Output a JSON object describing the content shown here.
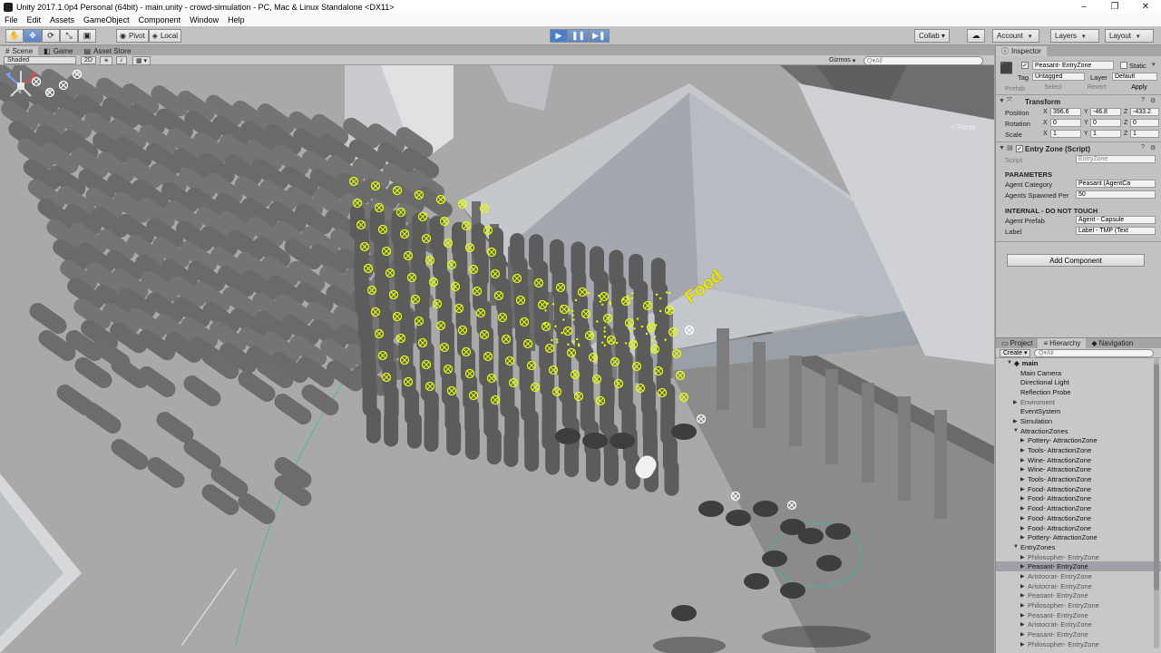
{
  "window": {
    "title": "Unity 2017.1.0p4 Personal (64bit) - main.unity - crowd-simulation - PC, Mac & Linux Standalone <DX11>",
    "controls": [
      "–",
      "❐",
      "✕"
    ]
  },
  "menu": [
    "File",
    "Edit",
    "Assets",
    "GameObject",
    "Component",
    "Window",
    "Help"
  ],
  "toolbar": {
    "pivot": "Pivot",
    "local": "Local",
    "collab": "Collab ▾",
    "account": "Account",
    "layers": "Layers",
    "layout": "Layout",
    "play_state": "playing"
  },
  "scene_tabs": [
    "Scene",
    "Game",
    "Asset Store"
  ],
  "scene_toolbar": {
    "shading": "Shaded",
    "mode_2d": "2D",
    "gizmos": "Gizmos",
    "search_placeholder": "Q▾All"
  },
  "viewport": {
    "projection": "< Persp",
    "world_label": "Food",
    "accent_color": "#e8ff00"
  },
  "inspector": {
    "tab": "Inspector",
    "object_name": "Peasant- EntryZone",
    "static_label": "Static",
    "tag_label": "Tag",
    "tag_value": "Untagged",
    "layer_label": "Layer",
    "layer_value": "Default",
    "prefab_label": "Prefab",
    "prefab_select": "Select",
    "prefab_revert": "Revert",
    "prefab_apply": "Apply",
    "transform": {
      "title": "Transform",
      "position_label": "Position",
      "position": {
        "x": "396.6",
        "y": "-46.8",
        "z": "-433.2"
      },
      "rotation_label": "Rotation",
      "rotation": {
        "x": "0",
        "y": "0",
        "z": "0"
      },
      "scale_label": "Scale",
      "scale": {
        "x": "1",
        "y": "1",
        "z": "1"
      }
    },
    "script_component": {
      "title": "Entry Zone (Script)",
      "script_label": "Script",
      "script_value": "EntryZone",
      "parameters_header": "PARAMETERS",
      "agent_category_label": "Agent Category",
      "agent_category_value": "Peasant (AgentCa",
      "agents_spawned_label": "Agents Spawned Per",
      "agents_spawned_value": "50",
      "internal_header": "INTERNAL - DO NOT TOUCH",
      "agent_prefab_label": "Agent Prefab",
      "agent_prefab_value": "Agent - Capsule",
      "label_label": "Label",
      "label_value": "Label - TMP (Text"
    },
    "add_component": "Add Component"
  },
  "hierarchy": {
    "tabs": [
      "Project",
      "Hierarchy",
      "Navigation"
    ],
    "create": "Create ▾",
    "search_placeholder": "Q▾All",
    "scene": "main",
    "items": [
      {
        "label": "Main Camera",
        "depth": 1,
        "arrow": ""
      },
      {
        "label": "Directional Light",
        "depth": 1,
        "arrow": ""
      },
      {
        "label": "Reflection Probe",
        "depth": 1,
        "arrow": ""
      },
      {
        "label": "Enviroment",
        "depth": 1,
        "arrow": "▶",
        "grey": true
      },
      {
        "label": "EventSystem",
        "depth": 1,
        "arrow": ""
      },
      {
        "label": "Simulation",
        "depth": 1,
        "arrow": "▶"
      },
      {
        "label": "AttractionZones",
        "depth": 1,
        "arrow": "▼"
      },
      {
        "label": "Pottery- AttractionZone",
        "depth": 2,
        "arrow": "▶"
      },
      {
        "label": "Tools- AttractionZone",
        "depth": 2,
        "arrow": "▶"
      },
      {
        "label": "Wine- AttractionZone",
        "depth": 2,
        "arrow": "▶"
      },
      {
        "label": "Wine- AttractionZone",
        "depth": 2,
        "arrow": "▶"
      },
      {
        "label": "Tools- AttractionZone",
        "depth": 2,
        "arrow": "▶"
      },
      {
        "label": "Food- AttractionZone",
        "depth": 2,
        "arrow": "▶"
      },
      {
        "label": "Food- AttractionZone",
        "depth": 2,
        "arrow": "▶"
      },
      {
        "label": "Food- AttractionZone",
        "depth": 2,
        "arrow": "▶"
      },
      {
        "label": "Food- AttractionZone",
        "depth": 2,
        "arrow": "▶"
      },
      {
        "label": "Food- AttractionZone",
        "depth": 2,
        "arrow": "▶"
      },
      {
        "label": "Pottery- AttractionZone",
        "depth": 2,
        "arrow": "▶"
      },
      {
        "label": "EntryZones",
        "depth": 1,
        "arrow": "▼"
      },
      {
        "label": "Philosopher- EntryZone",
        "depth": 2,
        "arrow": "▶",
        "grey": true
      },
      {
        "label": "Peasant- EntryZone",
        "depth": 2,
        "arrow": "▶",
        "selected": true
      },
      {
        "label": "Aristocrat- EntryZone",
        "depth": 2,
        "arrow": "▶",
        "grey": true
      },
      {
        "label": "Aristocrat- EntryZone",
        "depth": 2,
        "arrow": "▶",
        "grey": true
      },
      {
        "label": "Peasant- EntryZone",
        "depth": 2,
        "arrow": "▶",
        "grey": true
      },
      {
        "label": "Philosopher- EntryZone",
        "depth": 2,
        "arrow": "▶",
        "grey": true
      },
      {
        "label": "Peasant- EntryZone",
        "depth": 2,
        "arrow": "▶",
        "grey": true
      },
      {
        "label": "Aristocrat- EntryZone",
        "depth": 2,
        "arrow": "▶",
        "grey": true
      },
      {
        "label": "Peasant- EntryZone",
        "depth": 2,
        "arrow": "▶",
        "grey": true
      },
      {
        "label": "Philosopher- EntryZone",
        "depth": 2,
        "arrow": "▶",
        "grey": true
      }
    ]
  }
}
